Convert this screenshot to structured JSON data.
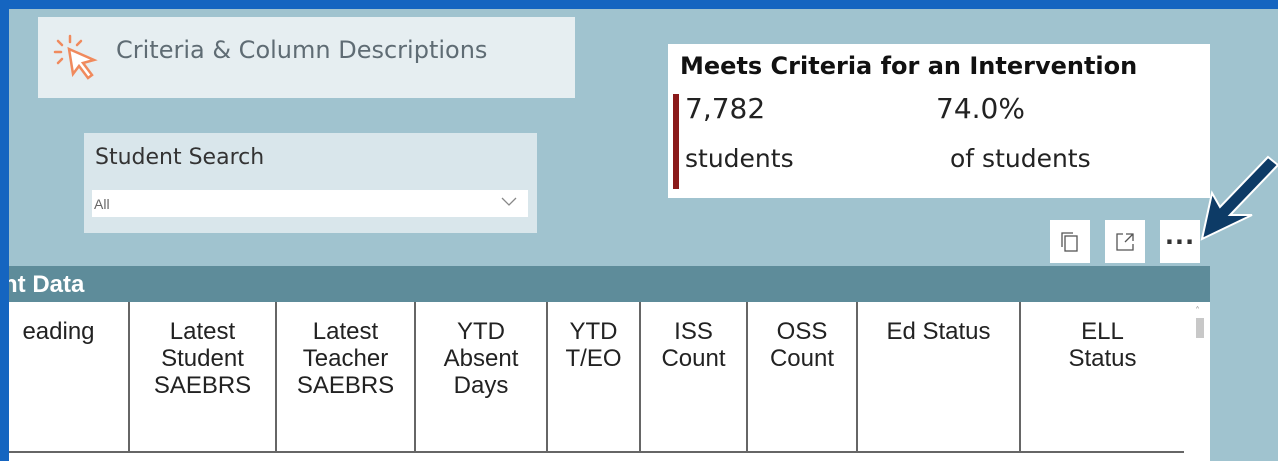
{
  "criteria_button": {
    "label": "Criteria & Column Descriptions",
    "icon": "cursor-click-icon"
  },
  "student_search": {
    "title": "Student Search",
    "value": "All",
    "icon": "chevron-down-icon"
  },
  "kpi": {
    "title": "Meets Criteria for an Intervention",
    "count": "7,782",
    "count_label": "students",
    "percent": "74.0%",
    "percent_label": "of students",
    "accent_color": "#8b1a1a"
  },
  "visual_header": {
    "icons": [
      "copy-icon",
      "focus-mode-icon",
      "more-options-icon"
    ],
    "more_label": "···"
  },
  "table": {
    "title": "lent Data",
    "columns": [
      "eading",
      "Latest\nStudent\nSAEBRS",
      "Latest\nTeacher\nSAEBRS",
      "YTD\nAbsent\nDays",
      "YTD\nT/EO",
      "ISS\nCount",
      "OSS\nCount",
      "Ed Status",
      "ELL\nStatus"
    ]
  },
  "colors": {
    "frame": "#1565c0",
    "canvas": "#a0c3cf",
    "table_header": "#5e8c9a",
    "arrow": "#0d3b66"
  }
}
